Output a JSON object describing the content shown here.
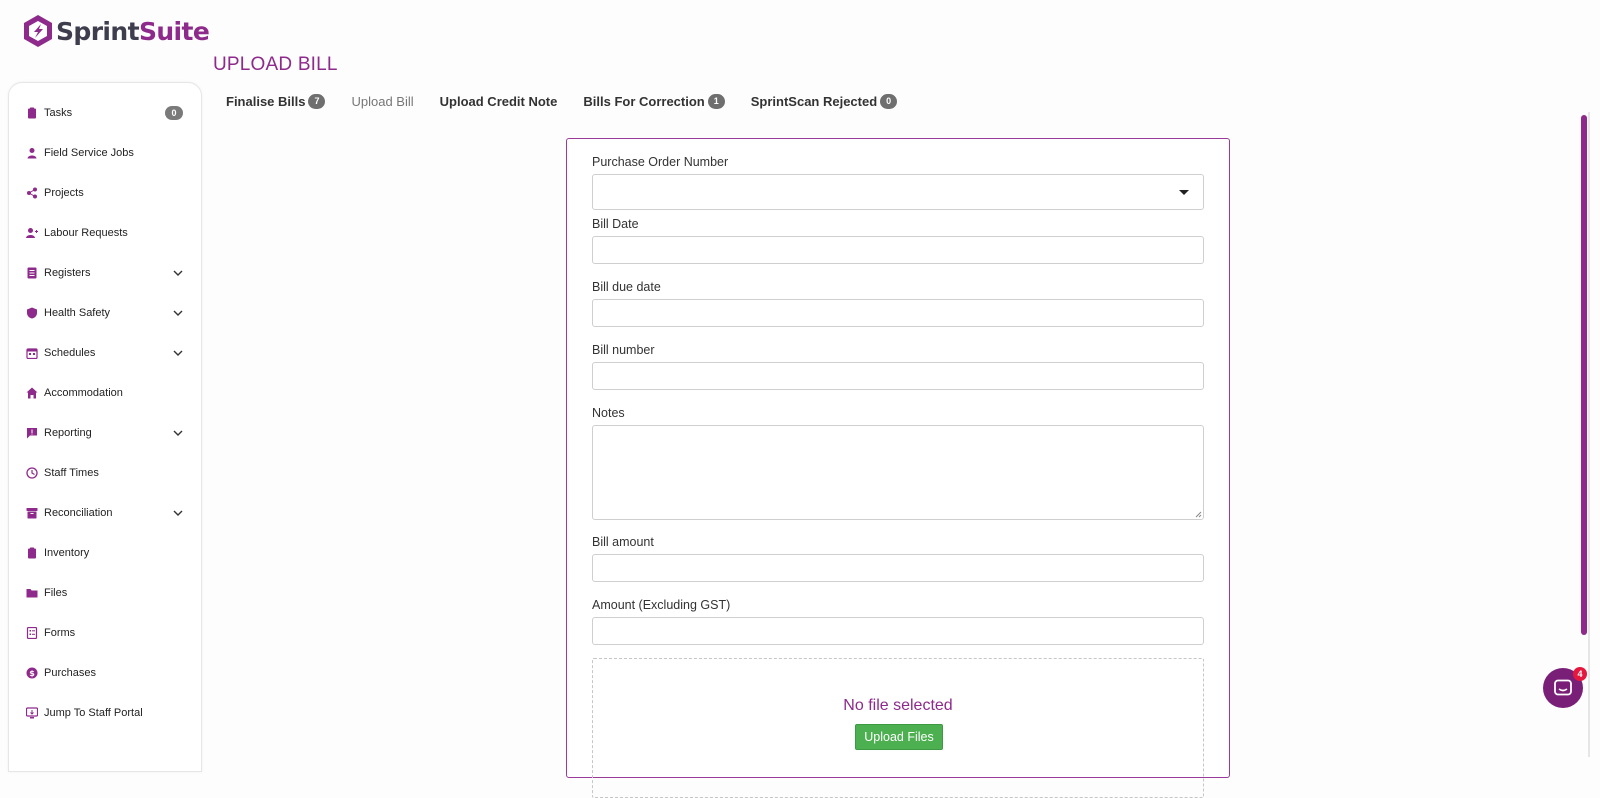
{
  "brand": {
    "name_prefix": "Sprint",
    "name_suffix": "Suite",
    "accent": "#8e2a8b"
  },
  "page": {
    "title": "UPLOAD BILL"
  },
  "sidebar": {
    "items": [
      {
        "label": "Tasks",
        "icon": "clipboard-icon",
        "badge": "0"
      },
      {
        "label": "Field Service Jobs",
        "icon": "worker-icon"
      },
      {
        "label": "Projects",
        "icon": "share-icon"
      },
      {
        "label": "Labour Requests",
        "icon": "user-plus-icon"
      },
      {
        "label": "Registers",
        "icon": "list-icon",
        "expandable": true
      },
      {
        "label": "Health Safety",
        "icon": "shield-icon",
        "expandable": true
      },
      {
        "label": "Schedules",
        "icon": "calendar-icon",
        "expandable": true
      },
      {
        "label": "Accommodation",
        "icon": "home-icon"
      },
      {
        "label": "Reporting",
        "icon": "report-icon",
        "expandable": true
      },
      {
        "label": "Staff Times",
        "icon": "clock-icon"
      },
      {
        "label": "Reconciliation",
        "icon": "archive-icon",
        "expandable": true
      },
      {
        "label": "Inventory",
        "icon": "clipboard-icon"
      },
      {
        "label": "Files",
        "icon": "folder-icon"
      },
      {
        "label": "Forms",
        "icon": "form-icon"
      },
      {
        "label": "Purchases",
        "icon": "dollar-icon"
      },
      {
        "label": "Jump To Staff Portal",
        "icon": "portal-icon"
      }
    ]
  },
  "tabs": [
    {
      "label": "Finalise Bills",
      "badge": "7"
    },
    {
      "label": "Upload Bill",
      "active": true
    },
    {
      "label": "Upload Credit Note"
    },
    {
      "label": "Bills For Correction",
      "badge": "1"
    },
    {
      "label": "SprintScan Rejected",
      "badge": "0"
    }
  ],
  "form": {
    "po_label": "Purchase Order Number",
    "po_value": "",
    "bill_date_label": "Bill Date",
    "bill_date_value": "",
    "due_date_label": "Bill due date",
    "due_date_value": "",
    "bill_number_label": "Bill number",
    "bill_number_value": "",
    "notes_label": "Notes",
    "notes_value": "",
    "amount_label": "Bill amount",
    "amount_value": "",
    "amount_ex_label": "Amount (Excluding GST)",
    "amount_ex_value": "",
    "dropzone_text": "No file selected",
    "upload_button": "Upload Files"
  },
  "chat": {
    "badge": "4"
  }
}
